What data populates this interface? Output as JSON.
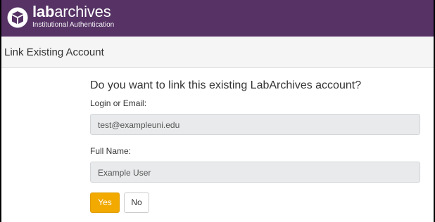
{
  "brand": {
    "name_bold": "lab",
    "name_rest": "archives",
    "subtitle": "Institutional Authentication",
    "logo_icon": "box-icon",
    "color": "#563265"
  },
  "panel": {
    "title": "Link Existing Account"
  },
  "form": {
    "question": "Do you want to link this existing LabArchives account?",
    "login_label": "Login or Email:",
    "login_value": "test@exampleuni.edu",
    "name_label": "Full Name:",
    "name_value": "Example User"
  },
  "buttons": {
    "yes_label": "Yes",
    "no_label": "No",
    "yes_color": "#f2a900"
  }
}
